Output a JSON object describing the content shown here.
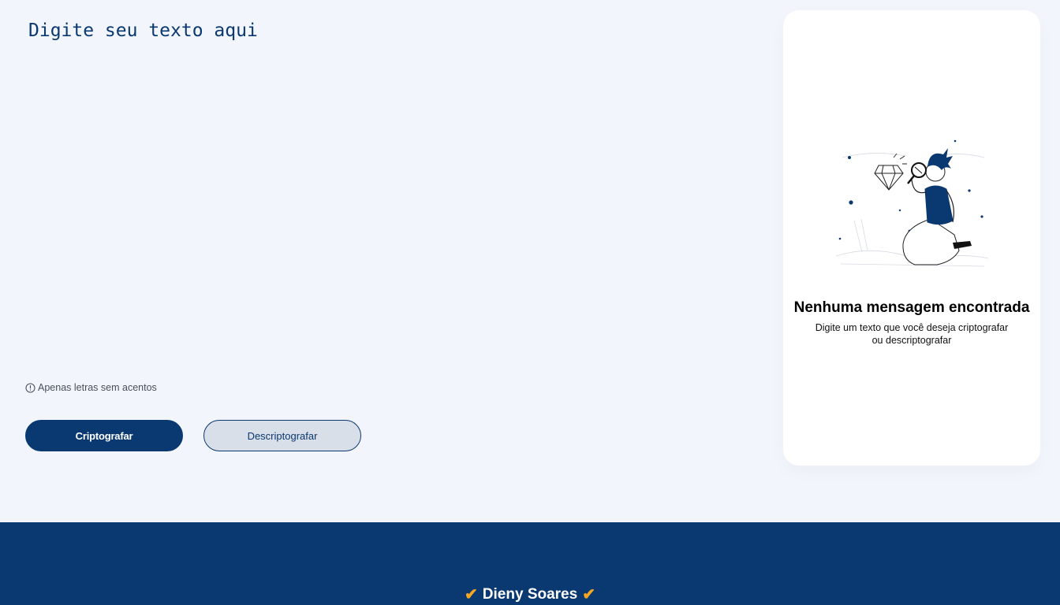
{
  "editor": {
    "placeholder": "Digite seu texto aqui"
  },
  "hint": {
    "icon": "info-circle-icon",
    "text": "Apenas letras sem acentos"
  },
  "buttons": {
    "encrypt_label": "Criptografar",
    "decrypt_label": "Descriptografar"
  },
  "output_panel": {
    "illustration": "person-with-magnifying-glass-and-diamond",
    "title": "Nenhuma mensagem encontrada",
    "text_line1": "Digite um texto que você deseja criptografar",
    "text_line2": "ou descriptografar"
  },
  "footer": {
    "check_left": "✔",
    "author": "Dieny Soares",
    "check_right": "✔"
  },
  "colors": {
    "primary": "#0a3871",
    "background": "#f3f5fc",
    "secondary_button": "#d8dfe8",
    "accent_check": "#f5a623"
  }
}
